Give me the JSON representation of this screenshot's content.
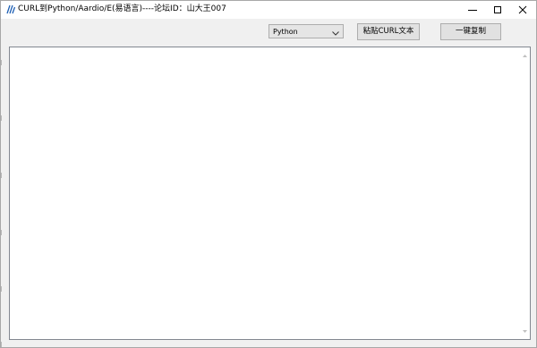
{
  "window": {
    "title": "CURL到Python/Aardio/E(易语言)----论坛ID：山大王007",
    "controls": [
      "minimize",
      "maximize",
      "close"
    ]
  },
  "toolbar": {
    "language_select": {
      "selected": "Python",
      "icon": "chevron-down-icon"
    },
    "paste_button_label": "粘贴CURL文本",
    "copy_button_label": "一键复制"
  },
  "editor": {
    "value": ""
  },
  "colors": {
    "background": "#f0f0f0",
    "titlebar": "#ffffff",
    "button": "#e1e1e1",
    "border": "#adadad",
    "app_icon": "#1e5fb4"
  }
}
